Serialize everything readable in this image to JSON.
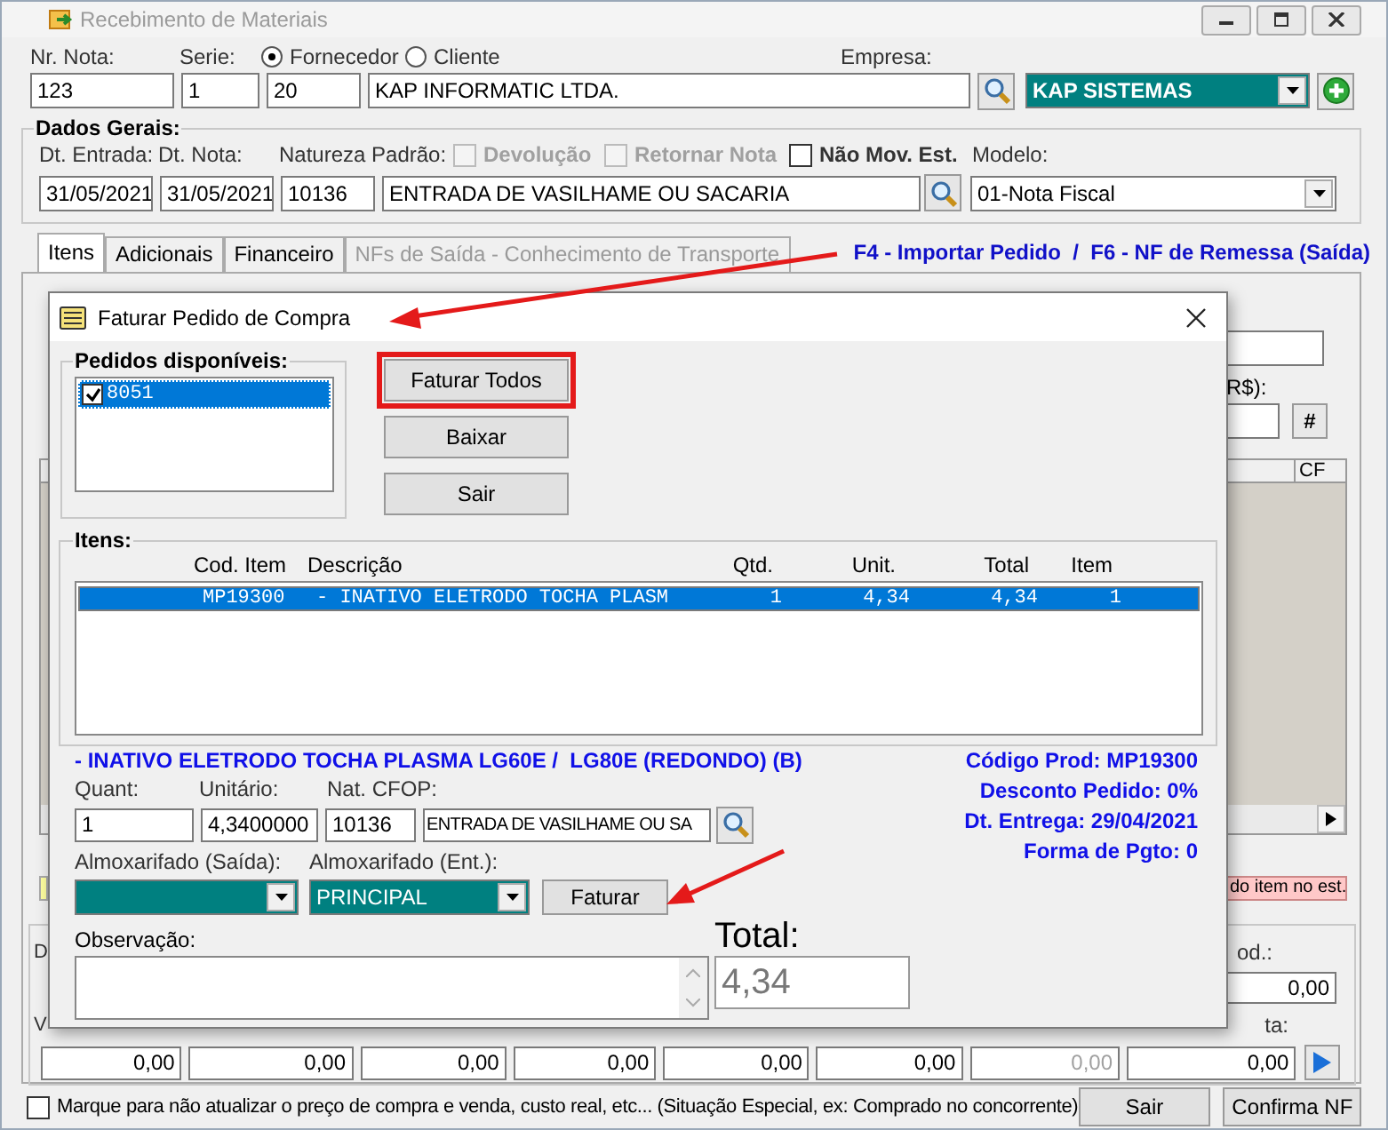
{
  "window": {
    "title": "Recebimento de Materiais"
  },
  "header": {
    "nr_nota_label": "Nr. Nota:",
    "nr_nota": "123",
    "serie_label": "Serie:",
    "serie": "1",
    "serie_2": "20",
    "party_types": [
      {
        "label": "Fornecedor",
        "selected": true
      },
      {
        "label": "Cliente",
        "selected": false
      }
    ],
    "party_name": "KAP INFORMATIC LTDA.",
    "empresa_label": "Empresa:",
    "empresa": "KAP SISTEMAS"
  },
  "dados_gerais": {
    "title": "Dados Gerais:",
    "dt_entrada_label": "Dt. Entrada:",
    "dt_entrada": "31/05/2021",
    "dt_nota_label": "Dt. Nota:",
    "dt_nota": "31/05/2021",
    "natureza_label": "Natureza Padrão:",
    "natureza_code": "10136",
    "natureza_desc": "ENTRADA DE VASILHAME OU SACARIA",
    "options": [
      {
        "label": "Devolução",
        "checked": false,
        "disabled": true
      },
      {
        "label": "Retornar Nota",
        "checked": false,
        "disabled": true
      },
      {
        "label": "Não Mov. Est.",
        "checked": false,
        "disabled": false
      }
    ],
    "modelo_label": "Modelo:",
    "modelo": "01-Nota Fiscal"
  },
  "tabs": [
    {
      "label": "Itens",
      "selected": true,
      "disabled": false
    },
    {
      "label": "Adicionais",
      "selected": false,
      "disabled": false
    },
    {
      "label": "Financeiro",
      "selected": false,
      "disabled": false
    },
    {
      "label": "NFs de Saída - Conhecimento de Transporte",
      "selected": false,
      "disabled": true
    }
  ],
  "shortcut_hint": "F4 - Importar Pedido  /  F6 - NF de Remessa (Saída)",
  "items_panel": {
    "value_label": "R$):",
    "button_label": "#",
    "table_column": "CF",
    "status_text": "do item no est."
  },
  "totals": {
    "label_1": "D",
    "label_2": "od.:",
    "value_1": "0,00",
    "label_3": "V",
    "label_4": "ta:",
    "values": [
      {
        "value": "0,00",
        "disabled": false
      },
      {
        "value": "0,00",
        "disabled": false
      },
      {
        "value": "0,00",
        "disabled": false
      },
      {
        "value": "0,00",
        "disabled": false
      },
      {
        "value": "0,00",
        "disabled": false
      },
      {
        "value": "0,00",
        "disabled": false
      },
      {
        "value": "0,00",
        "disabled": true
      },
      {
        "value": "0,00",
        "disabled": false
      }
    ]
  },
  "footer": {
    "option": {
      "label": "Marque para não atualizar o preço de compra e venda, custo real, etc... (Situação Especial, ex: Comprado no concorrente)",
      "checked": false
    },
    "buttons": [
      "Sair",
      "Confirma NF"
    ]
  },
  "dialog": {
    "title": "Faturar Pedido de Compra",
    "orders_label": "Pedidos disponíveis:",
    "orders": [
      {
        "label": "8051",
        "checked": true,
        "selected": true
      }
    ],
    "buttons": [
      {
        "label": "Faturar Todos",
        "highlighted": true
      },
      {
        "label": "Baixar",
        "highlighted": false
      },
      {
        "label": "Sair",
        "highlighted": false
      }
    ],
    "items_label": "Itens:",
    "items_table": {
      "columns": [
        "Cod. Item",
        "Descrição",
        "Qtd.",
        "Unit.",
        "Total",
        "Item"
      ],
      "rows": [
        {
          "cells": [
            "MP19300",
            "- INATIVO ELETRODO TOCHA PLASM",
            "1",
            "4,34",
            "4,34",
            "1"
          ],
          "selected": true
        }
      ]
    },
    "description": "- INATIVO ELETRODO TOCHA PLASMA LG60E /  LG80E (REDONDO) (B)",
    "info": [
      "Código Prod: MP19300",
      "Desconto Pedido: 0%",
      "Dt. Entrega: 29/04/2021",
      "Forma de Pgto: 0"
    ],
    "quant_label": "Quant:",
    "quant": "1",
    "unitario_label": "Unitário:",
    "unitario": "4,3400000",
    "cfop_label": "Nat. CFOP:",
    "cfop_code": "10136",
    "cfop_desc": "ENTRADA DE VASILHAME OU SA",
    "alm_saida_label": "Almoxarifado (Saída):",
    "alm_ent_label": "Almoxarifado (Ent.):",
    "alm_ent": "PRINCIPAL",
    "faturar_label": "Faturar",
    "observacao_label": "Observação:",
    "total_label": "Total:",
    "total": "4,34"
  }
}
